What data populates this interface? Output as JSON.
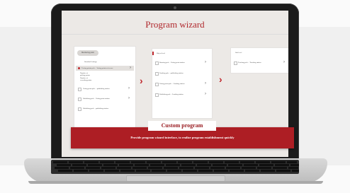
{
  "screen": {
    "title": "Program wizard"
  },
  "panel1": {
    "pill": "Monitoring point",
    "items": [
      "Standard Settings",
      "Testing points pole – Voting points reference",
      "Number of\npolling points",
      "Number of\nrecording points",
      "Voting point pole – publishing station",
      "Publishing pole – Voting point station",
      "Publishing pole – publishing station"
    ]
  },
  "panel2": {
    "items": [
      "Object level",
      "Running pole – Voting point station",
      "Funding pole – publishing station",
      "Voting point pole – Landing station",
      "Publishing pole – Landing station"
    ]
  },
  "panel3": {
    "items": [
      "Sub level",
      "Tracking pole – Tracking station"
    ]
  },
  "custom": {
    "label": "Custom program",
    "description": "Provide program wizard interface, to realize program establishment quickly"
  },
  "colors": {
    "accent": "#b0282d",
    "banner": "#ad1e24"
  }
}
